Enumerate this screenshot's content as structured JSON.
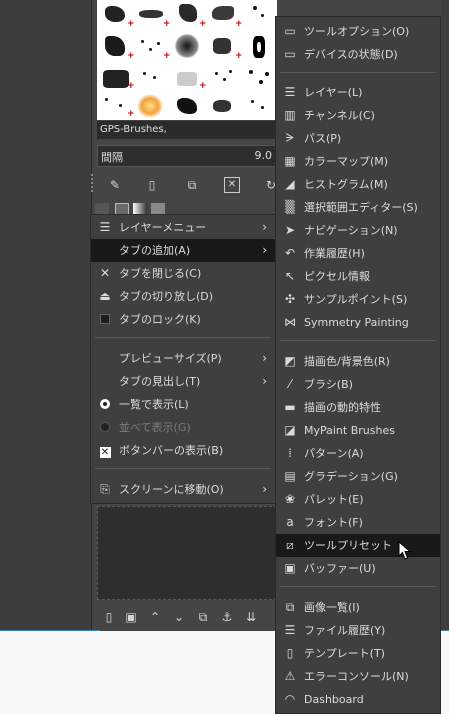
{
  "brushes_panel": {
    "selected_brush": "GPS-Brushes,",
    "spacing_label": "間隔",
    "spacing_value": "9.0"
  },
  "tab_menu": {
    "items": [
      {
        "label": "レイヤーメニュー",
        "icon": "layer-stack-icon",
        "submenu": true
      },
      {
        "label": "タブの追加(A)",
        "icon": "",
        "submenu": true,
        "highlighted": true
      },
      {
        "label": "タブを閉じる(C)",
        "icon": "close-x-icon"
      },
      {
        "label": "タブの切り放し(D)",
        "icon": "eject-icon"
      },
      {
        "label": "タブのロック(K)",
        "icon": "checkbox-icon"
      },
      {
        "label": "プレビューサイズ(P)",
        "icon": "",
        "submenu": true
      },
      {
        "label": "タブの見出し(T)",
        "icon": "",
        "submenu": true
      },
      {
        "label": "一覧で表示(L)",
        "icon": "radio-checked-icon"
      },
      {
        "label": "並べて表示(G)",
        "icon": "radio-unchecked-icon",
        "disabled": true
      },
      {
        "label": "ボタンバーの表示(B)",
        "icon": "checkmark-icon"
      },
      {
        "label": "スクリーンに移動(O)",
        "icon": "screen-move-icon",
        "submenu": true
      }
    ]
  },
  "add_tab_submenu": {
    "items": [
      {
        "label": "ツールオプション(O)",
        "icon": "tool-options-icon"
      },
      {
        "label": "デバイスの状態(D)",
        "icon": "device-status-icon"
      },
      {
        "label": "レイヤー(L)",
        "icon": "layers-icon"
      },
      {
        "label": "チャンネル(C)",
        "icon": "channels-icon"
      },
      {
        "label": "パス(P)",
        "icon": "paths-icon"
      },
      {
        "label": "カラーマップ(M)",
        "icon": "colormap-icon"
      },
      {
        "label": "ヒストグラム(M)",
        "icon": "histogram-icon"
      },
      {
        "label": "選択範囲エディター(S)",
        "icon": "selection-editor-icon"
      },
      {
        "label": "ナビゲーション(N)",
        "icon": "navigation-icon"
      },
      {
        "label": "作業履歴(H)",
        "icon": "undo-history-icon"
      },
      {
        "label": "ピクセル情報",
        "icon": "pointer-icon"
      },
      {
        "label": "サンプルポイント(S)",
        "icon": "sample-points-icon"
      },
      {
        "label": "Symmetry Painting",
        "icon": "symmetry-icon"
      },
      {
        "label": "描画色/背景色(R)",
        "icon": "fg-bg-colors-icon"
      },
      {
        "label": "ブラシ(B)",
        "icon": "brush-icon"
      },
      {
        "label": "描画の動的特性",
        "icon": "paint-dynamics-icon"
      },
      {
        "label": "MyPaint Brushes",
        "icon": "mypaint-brushes-icon"
      },
      {
        "label": "パターン(A)",
        "icon": "patterns-icon"
      },
      {
        "label": "グラデーション(G)",
        "icon": "gradients-icon"
      },
      {
        "label": "パレット(E)",
        "icon": "palette-icon"
      },
      {
        "label": "フォント(F)",
        "icon": "fonts-icon"
      },
      {
        "label": "ツールプリセット",
        "icon": "tool-presets-icon",
        "highlighted": true
      },
      {
        "label": "バッファー(U)",
        "icon": "buffers-icon"
      },
      {
        "label": "画像一覧(I)",
        "icon": "images-icon"
      },
      {
        "label": "ファイル履歴(Y)",
        "icon": "document-history-icon"
      },
      {
        "label": "テンプレート(T)",
        "icon": "templates-icon"
      },
      {
        "label": "エラーコンソール(N)",
        "icon": "error-console-icon"
      },
      {
        "label": "Dashboard",
        "icon": "dashboard-icon"
      }
    ]
  }
}
